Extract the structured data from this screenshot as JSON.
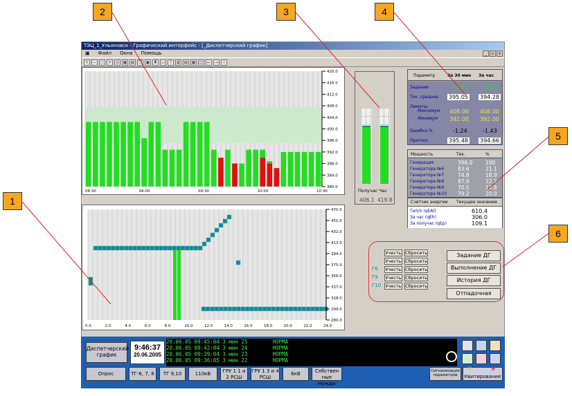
{
  "callouts": [
    "1",
    "2",
    "3",
    "4",
    "5",
    "6"
  ],
  "window": {
    "title": "ТЭЦ_1_Ульяновск - Графический интерфейс - [_Диспетчерский график]",
    "menu": [
      "Файл",
      "Окна",
      "Помощь"
    ],
    "controls": [
      "_",
      "▫",
      "x"
    ]
  },
  "top_chart": {
    "y_ticks": [
      "420.0",
      "416.0",
      "412.0",
      "408.0",
      "404.0",
      "400.0",
      "396.0",
      "392.0",
      "388.0",
      "384.0",
      "380.0"
    ],
    "x_ticks": [
      "08:30",
      "09:00",
      "09:30",
      "10:00",
      "10:30"
    ],
    "green_bars": [
      0.56,
      0.56,
      0.56,
      0.56,
      0.56,
      0.56,
      0.56,
      0.56,
      0.42,
      0.56,
      0.56,
      0.32,
      0.32,
      0.32,
      0.56,
      0.56,
      0.56,
      0.56,
      0.32,
      0.2,
      0.32,
      0.2,
      0.2,
      0.32,
      0.32,
      0.32,
      0.22,
      0.16,
      0.3,
      0.3,
      0.3,
      0.3,
      0.3,
      0.3
    ],
    "red_bars": [
      null,
      null,
      null,
      null,
      null,
      null,
      null,
      null,
      null,
      null,
      null,
      null,
      null,
      null,
      null,
      null,
      null,
      null,
      null,
      0.25,
      null,
      0.2,
      null,
      null,
      null,
      0.25,
      0.2,
      0.16,
      null,
      null,
      null,
      null,
      null,
      null
    ]
  },
  "bottom_chart": {
    "y_ticks": [
      "470.0",
      "451.0",
      "432.0",
      "413.0",
      "394.0",
      "375.0",
      "356.0",
      "337.0",
      "318.0",
      "299.0",
      "280.0"
    ],
    "x_ticks": [
      "0.0",
      "2.0",
      "4.0",
      "6.0",
      "8.0",
      "10.0",
      "12.0",
      "14.0",
      "16.0",
      "18.0",
      "20.0",
      "22.0",
      "24.0"
    ]
  },
  "gauges": {
    "labels": [
      "Получас",
      "Час"
    ],
    "values": [
      "406.1",
      "419.8"
    ]
  },
  "table_params": {
    "headers": [
      "Параметр",
      "За 30 мин",
      "За час"
    ],
    "rows": [
      {
        "label": "Задание",
        "v1": "400.0",
        "v2": "400.0"
      },
      {
        "label": "Тек. среднее",
        "v1": "395.05",
        "v2": "394.28"
      },
      {
        "label": "Лимиты",
        "v1": "",
        "v2": ""
      },
      {
        "label": "Максимум",
        "v1": "408.00",
        "v2": "408.00"
      },
      {
        "label": "Минимум",
        "v1": "392.00",
        "v2": "392.00"
      },
      {
        "label": "Ошибка  %",
        "v1": "-1.24",
        "v2": "-1.43"
      },
      {
        "label": "Прогноз",
        "v1": "395.48",
        "v2": "394.66"
      }
    ]
  },
  "table_power": {
    "headers": [
      "Мощность",
      "Тек.",
      "%"
    ],
    "rows": [
      {
        "label": "Генерация",
        "v1": "396.0",
        "v2": "100"
      },
      {
        "label": "Генератора №6",
        "v1": "83.6",
        "v2": "21.1"
      },
      {
        "label": "Генератора №7",
        "v1": "74.8",
        "v2": "18.9"
      },
      {
        "label": "Генератора №8",
        "v1": "87.9",
        "v2": "22.2"
      },
      {
        "label": "Генератора №9",
        "v1": "70.5",
        "v2": "17.8"
      },
      {
        "label": "Генератора №10",
        "v1": "79.2",
        "v2": "20.0"
      }
    ]
  },
  "table_energy": {
    "headers": [
      "Счетчик энергии",
      "Текущее значение"
    ],
    "rows": [
      {
        "label": "Тип/п (qEAt)",
        "v": "610.4"
      },
      {
        "label": "За час (qEh)",
        "v": "306.0"
      },
      {
        "label": "За получас (qEp)",
        "v": "109.1"
      }
    ]
  },
  "gen_controls": {
    "labels": [
      "Г6",
      "Г9",
      "Г10"
    ],
    "accept": "Учесть",
    "reset": "Сбросить"
  },
  "dg_buttons": [
    "Задание ДГ",
    "Выполнение ДГ",
    "История ДГ",
    "Отпадочная"
  ],
  "status_bar": {
    "panel_label": "Диспетчерский график",
    "time": "9:46:37",
    "date": "20.06.2005",
    "log": [
      "20.06.05 09:45:04 3 мин 25        НОРМА",
      "20.06.05 09:42:04 3 мин 24        НОРМА",
      "20.06.05 09:39:04 3 мин 23        НОРМА",
      "20.06.05 09:36:05 3 мин 22        НОРМА"
    ],
    "tabs": [
      "Опрос",
      "ТГ-6, 7, 8",
      "ТГ 9,10",
      "110кВ",
      "ГРУ 1 1 и 2 РСШ",
      "ГРУ 1 3 и 4 РСШ",
      "6кВ",
      "Собствен ные нужды"
    ],
    "signal_label": "Сигнализация параметров",
    "ack_label": "Квитирование"
  },
  "colors": {
    "green": "#22dd22",
    "red": "#e01010",
    "teal": "#0a8c8c",
    "status_blue": "#1e5fb4"
  }
}
